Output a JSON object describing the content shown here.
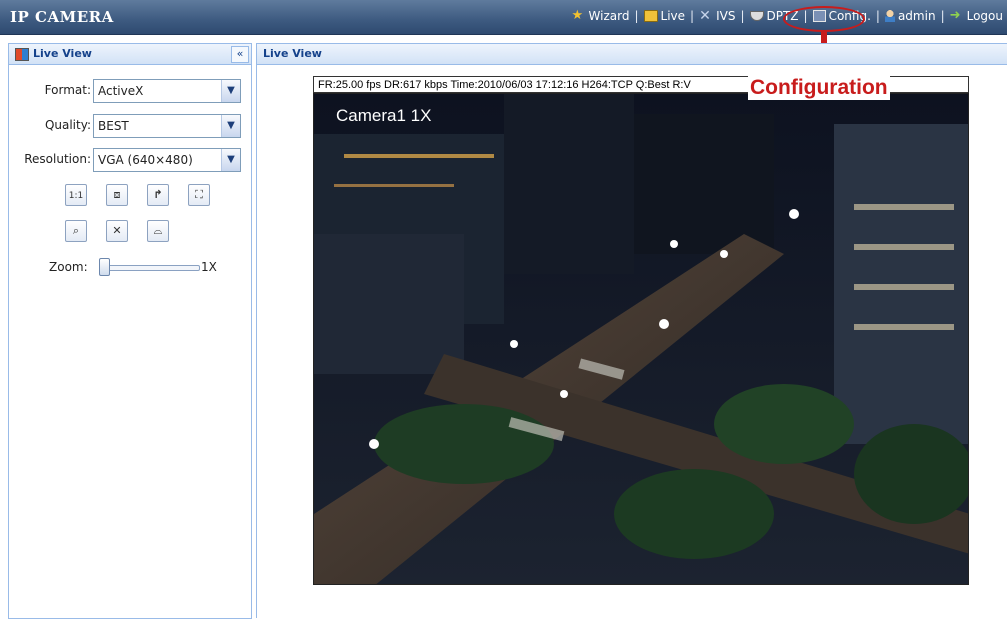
{
  "app": {
    "title": "IP CAMERA"
  },
  "nav": {
    "wizard": "Wizard",
    "live": "Live",
    "ivs": "IVS",
    "dptz": "DPTZ",
    "config": "Config.",
    "admin": "admin",
    "logout": "Logou"
  },
  "annotation": {
    "text": "Configuration"
  },
  "left_panel": {
    "title": "Live View",
    "format_label": "Format:",
    "format_value": "ActiveX",
    "quality_label": "Quality:",
    "quality_value": "BEST",
    "resolution_label": "Resolution:",
    "resolution_value": "VGA (640×480)",
    "zoom_label": "Zoom:",
    "zoom_value": "1X"
  },
  "right_panel": {
    "title": "Live View",
    "status_line": "FR:25.00 fps  DR:617 kbps  Time:2010/06/03 17:12:16  H264:TCP  Q:Best  R:V",
    "camera_overlay": "Camera1 1X"
  },
  "icons": {
    "wizard": "star-icon",
    "live": "monitor-icon",
    "ivs": "ivs-icon",
    "dptz": "dome-camera-icon",
    "config": "config-icon",
    "admin": "user-icon",
    "logout": "logout-icon"
  },
  "colors": {
    "header": "#3d5a80",
    "annotation": "#c81c1c",
    "panel_title": "#15428b"
  }
}
